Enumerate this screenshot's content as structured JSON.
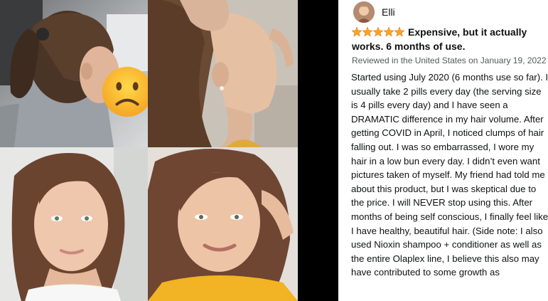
{
  "collage": {
    "photos": [
      {
        "name": "before-photo-ponytail",
        "emoji_icon": "frowning-face-emoji"
      },
      {
        "name": "before-photo-side-profile"
      },
      {
        "name": "after-photo-front"
      },
      {
        "name": "after-photo-smiling"
      }
    ]
  },
  "review": {
    "reviewer": {
      "name": "Elli"
    },
    "rating": {
      "stars": 5,
      "max": 5,
      "color": "#ffa41c"
    },
    "title": "Expensive, but it actually works. 6 months of use.",
    "meta": "Reviewed in the United States on January 19, 2022",
    "body": "Started using July 2020 (6 months use so far). I usually take 2 pills every day (the serving size is 4 pills every day) and I have seen a DRAMATIC difference in my hair volume. After getting COVID in April, I noticed clumps of hair falling out. I was so embarrassed, I wore my hair in a low bun every day. I didn’t even want pictures taken of myself. My friend had told me about this product, but I was skeptical due to the price. I will NEVER stop using this. After months of being self conscious, I finally feel like I have healthy, beautiful hair. (Side note: I also used Nioxin shampoo + conditioner as well as the entire Olaplex line, I believe this also may have contributed to some growth as"
  }
}
